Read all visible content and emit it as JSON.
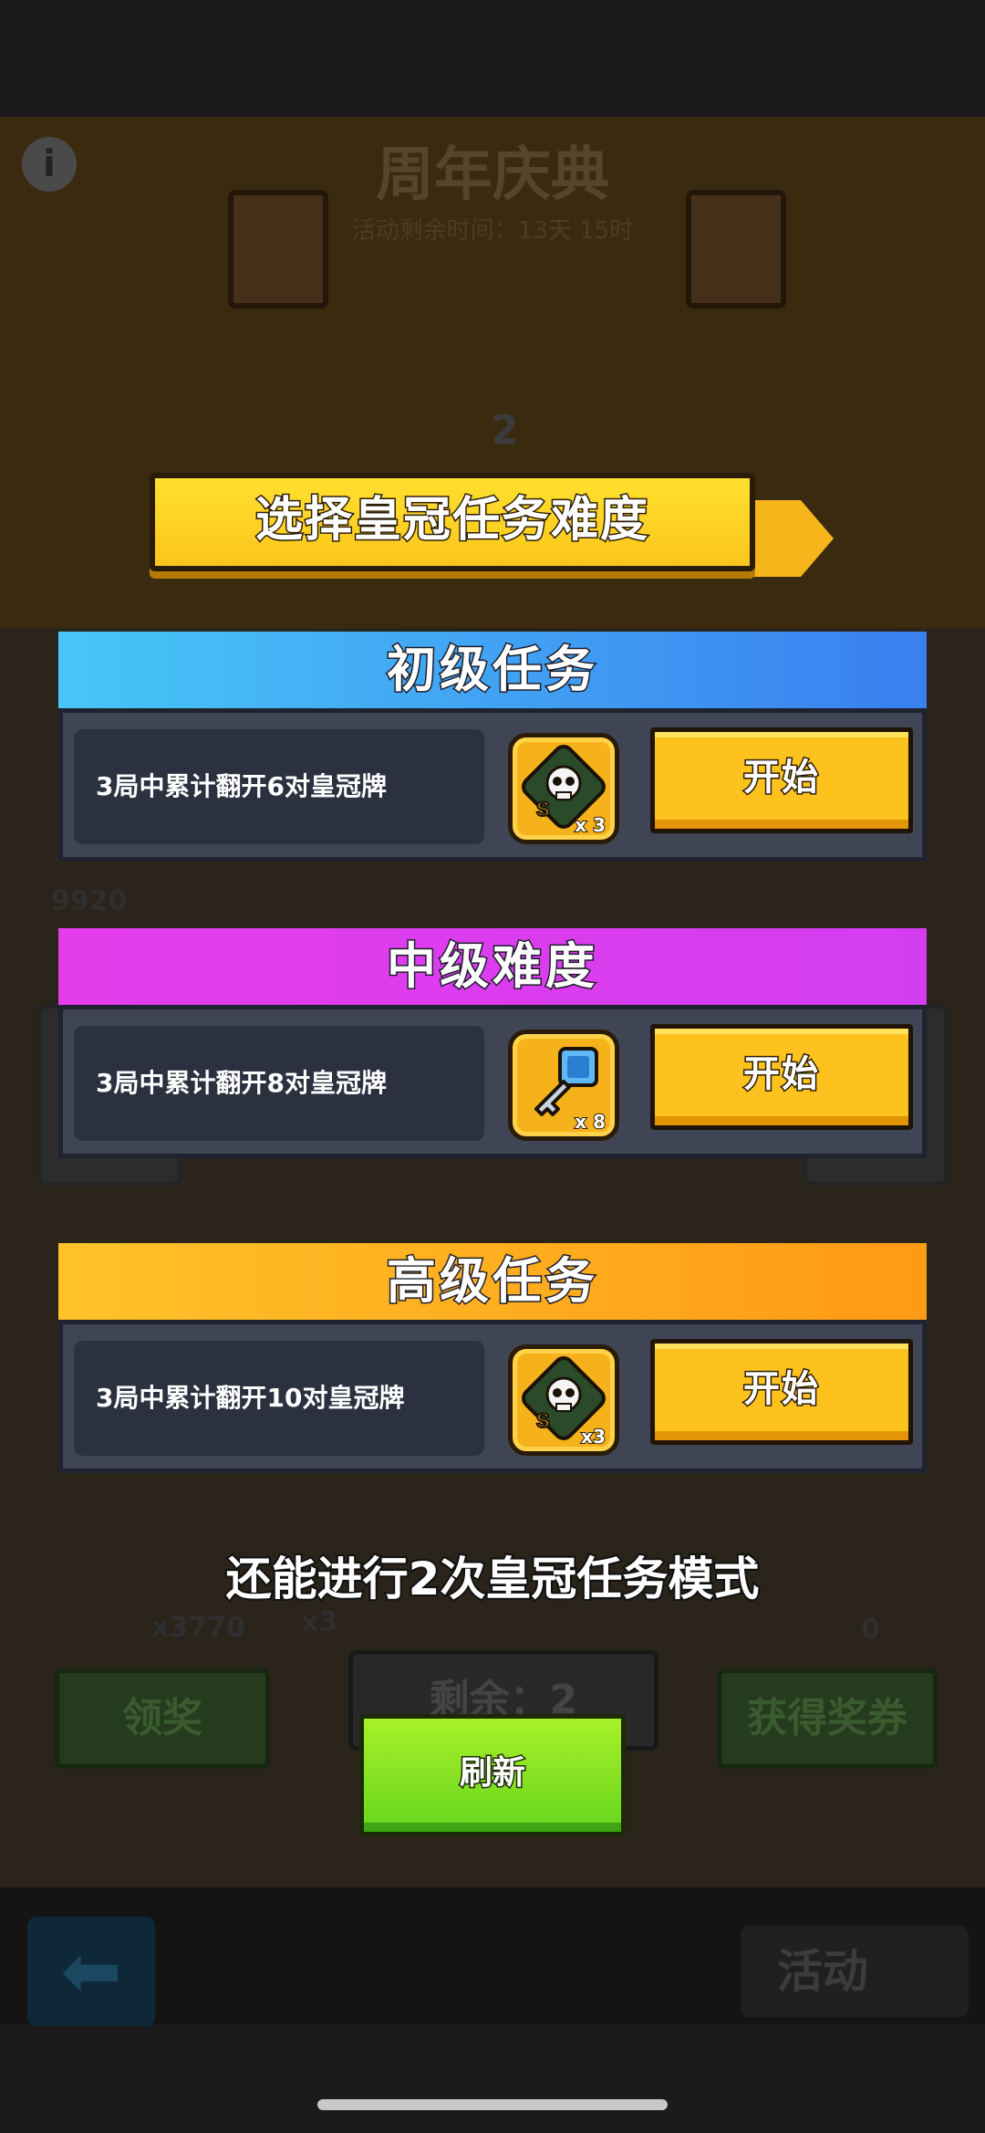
{
  "background": {
    "title": "周年庆典",
    "timer": "活动剩余时间：13天 15时",
    "score_a": "9920",
    "number_2": "2",
    "left_button": "领奖",
    "middle_button": "剩余：2",
    "right_button": "获得奖券",
    "count_left": "x3770",
    "count_badge": "x3",
    "count_right": "0",
    "activity_label": "活动"
  },
  "dialog": {
    "title": "选择皇冠任务难度",
    "missions": [
      {
        "header": "初级任务",
        "header_color_from": "#48c6f7",
        "header_color_to": "#3a7ff0",
        "description": "3局中累计翻开6对皇冠牌",
        "reward_icon": "skull-ticket-icon",
        "reward_count": "x 3",
        "button": "开始"
      },
      {
        "header": "中级难度",
        "header_color_from": "#e43dec",
        "header_color_to": "#d33df0",
        "description": "3局中累计翻开8对皇冠牌",
        "reward_icon": "key-icon",
        "reward_count": "x 8",
        "button": "开始"
      },
      {
        "header": "高级任务",
        "header_color_from": "#ffc22a",
        "header_color_to": "#ff9a14",
        "description": "3局中累计翻开10对皇冠牌",
        "reward_icon": "skull-ticket-icon",
        "reward_count": "x3",
        "button": "开始"
      }
    ],
    "remaining": "还能进行2次皇冠任务模式",
    "refresh_button": "刷新"
  }
}
